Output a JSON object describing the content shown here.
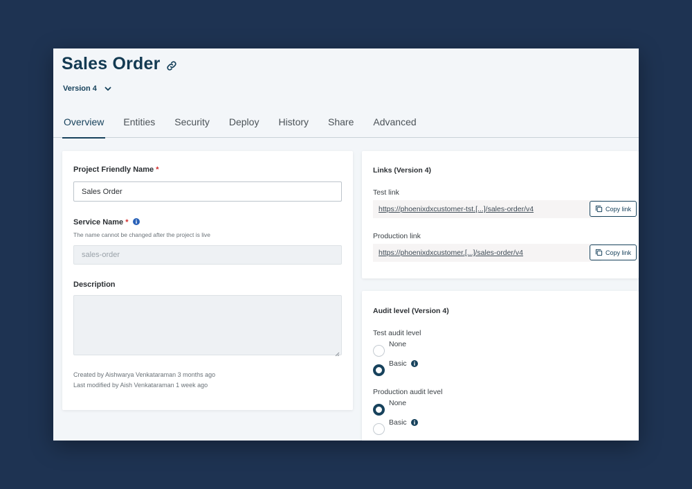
{
  "header": {
    "title": "Sales Order",
    "version_label": "Version 4"
  },
  "tabs": [
    {
      "label": "Overview",
      "active": true
    },
    {
      "label": "Entities"
    },
    {
      "label": "Security"
    },
    {
      "label": "Deploy"
    },
    {
      "label": "History"
    },
    {
      "label": "Share"
    },
    {
      "label": "Advanced"
    }
  ],
  "project_form": {
    "friendly_name_label": "Project Friendly Name",
    "required_mark": "*",
    "friendly_name_value": "Sales Order",
    "service_name_label": "Service Name",
    "service_name_hint": "The name cannot be changed after the project is live",
    "service_name_placeholder": "sales-order",
    "description_label": "Description",
    "created_by": "Created by Aishwarya Venkataraman 3 months ago",
    "modified_by": "Last modified by Aish Venkataraman 1 week ago"
  },
  "links": {
    "title": "Links (Version 4)",
    "test_label": "Test link",
    "test_url": "https://phoenixdxcustomer-tst.[...]/sales-order/v4",
    "prod_label": "Production link",
    "prod_url": "https://phoenixdxcustomer.[...]/sales-order/v4",
    "copy_label": "Copy link"
  },
  "audit": {
    "title": "Audit level (Version 4)",
    "test_label": "Test audit level",
    "test_options": [
      "None",
      "Basic"
    ],
    "test_selected": "Basic",
    "prod_label": "Production audit level",
    "prod_options": [
      "None",
      "Basic"
    ],
    "prod_selected": "None"
  },
  "colors": {
    "backdrop": "#1e3352",
    "accent": "#17425c",
    "required": "#d02b2b"
  }
}
